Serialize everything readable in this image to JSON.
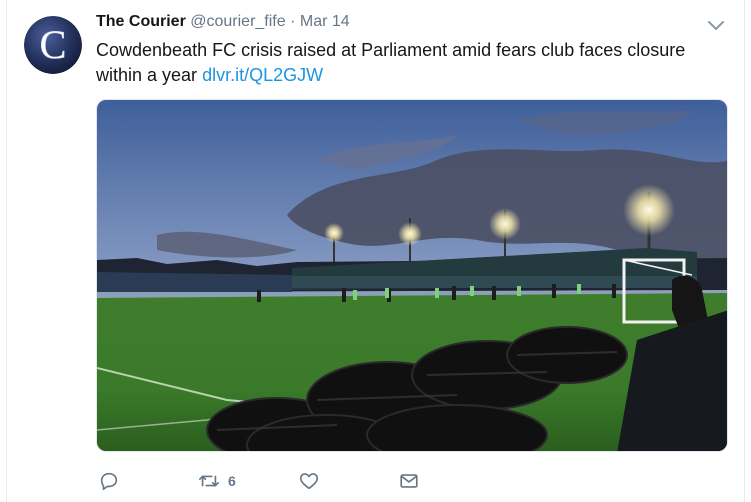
{
  "tweet": {
    "author_name": "The Courier",
    "handle": "@courier_fife",
    "separator": "·",
    "date": "Mar 14",
    "text": "Cowdenbeath FC crisis raised at Parliament amid fears club faces closure within a year",
    "link_text": "dlvr.it/QL2GJW",
    "avatar_letter": "C",
    "retweet_count": "6"
  },
  "colors": {
    "link": "#1b95e0",
    "secondary_text": "#657786",
    "avatar_bg": "#2b3c6e"
  },
  "icons": {
    "menu": "chevron-down-icon",
    "reply": "reply-icon",
    "retweet": "retweet-icon",
    "like": "heart-icon",
    "message": "envelope-icon"
  }
}
